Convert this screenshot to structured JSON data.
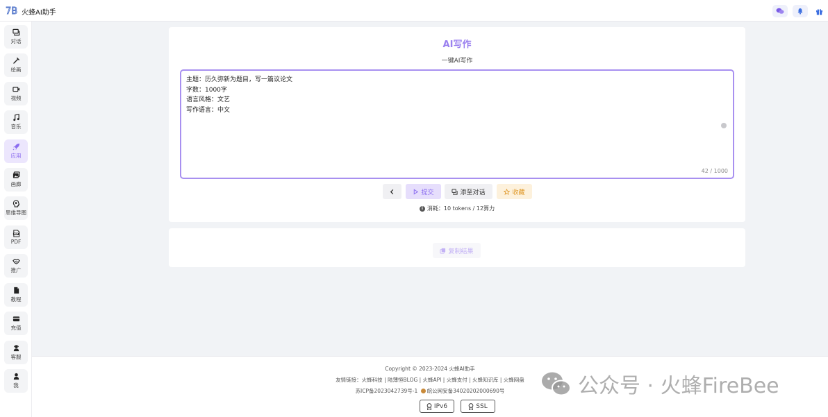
{
  "app": {
    "title": "火蜂AI助手"
  },
  "sidebar": {
    "items": [
      {
        "label": "对话",
        "icon": "chat-icon"
      },
      {
        "label": "绘画",
        "icon": "brush-icon"
      },
      {
        "label": "视频",
        "icon": "video-icon"
      },
      {
        "label": "音乐",
        "icon": "music-icon"
      },
      {
        "label": "应用",
        "icon": "rocket-icon",
        "active": true
      },
      {
        "label": "画廊",
        "icon": "gallery-icon"
      },
      {
        "label": "思维导图",
        "icon": "mindmap-icon"
      },
      {
        "label": "PDF",
        "icon": "pdf-icon"
      },
      {
        "label": "推广",
        "icon": "handshake-icon"
      },
      {
        "label": "教程",
        "icon": "document-icon"
      },
      {
        "label": "充值",
        "icon": "card-icon"
      },
      {
        "label": "客服",
        "icon": "support-icon"
      },
      {
        "label": "我",
        "icon": "user-icon"
      }
    ]
  },
  "main": {
    "title": "AI写作",
    "subtitle": "一键AI写作",
    "input_lines": [
      "主题：历久弥新为题目，写一篇议论文",
      "字数：1000字",
      "语言风格：文艺",
      "写作语言：中文"
    ],
    "counter": "42 / 1000",
    "buttons": {
      "back": "<",
      "submit": "提交",
      "add_to_chat": "添至对话",
      "favorite": "收藏"
    },
    "cost": "消耗：10 tokens / 12算力"
  },
  "result": {
    "copy_label": "复制结果"
  },
  "footer": {
    "copyright": "Copyright © 2023-2024 火蜂AI助手",
    "links": "友情链接：火蜂科技 | 陆薄恒BLOG | 火蜂API | 火蜂支付 | 火蜂知识库 | 火蜂网盘",
    "icp": "苏ICP备2023042739号-1",
    "police": "皖公网安备34020202000690号",
    "badges": [
      "IPv6",
      "SSL"
    ]
  },
  "watermark": {
    "text": "公众号 · 火蜂FireBee"
  },
  "colors": {
    "accent": "#9a80ef",
    "favorite": "#e9a23b",
    "active_bg": "#ece6fd"
  }
}
